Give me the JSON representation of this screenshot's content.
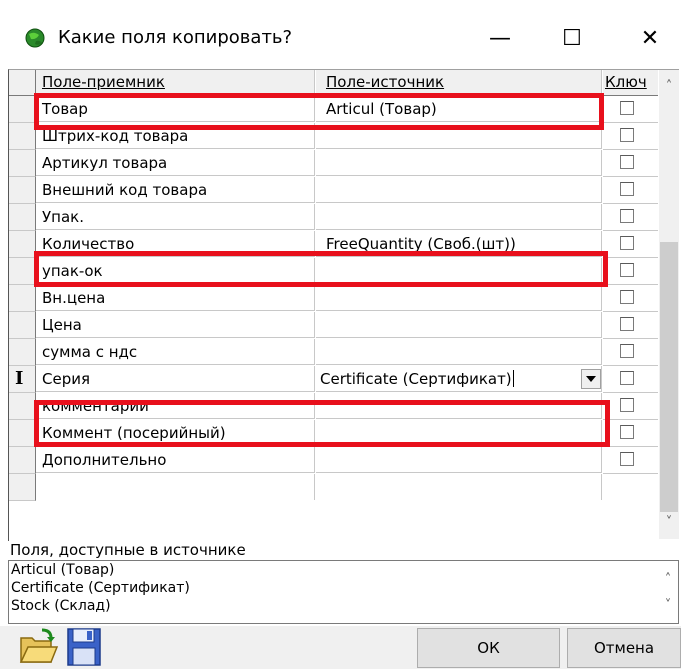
{
  "window": {
    "title": "Какие поля копировать?",
    "controls": {
      "minimize": "—",
      "maximize": "☐",
      "close": "✕"
    }
  },
  "grid": {
    "headers": {
      "target": "Поле-приемник",
      "source": "Поле-источник",
      "key": "Ключ"
    },
    "rows": [
      {
        "target": "Товар",
        "source": "Articul (Товар)"
      },
      {
        "target": "Штрих-код товара",
        "source": ""
      },
      {
        "target": "Артикул товара",
        "source": ""
      },
      {
        "target": "Внешний код товара",
        "source": ""
      },
      {
        "target": "Упак.",
        "source": ""
      },
      {
        "target": "Количество",
        "source": "FreeQuantity (Своб.(шт))"
      },
      {
        "target": "упак-ок",
        "source": ""
      },
      {
        "target": "Вн.цена",
        "source": ""
      },
      {
        "target": "Цена",
        "source": ""
      },
      {
        "target": "сумма с ндс",
        "source": ""
      },
      {
        "target": "Серия",
        "source": "Certificate (Сертификат)"
      },
      {
        "target": "комментарии",
        "source": ""
      },
      {
        "target": "Коммент (посерийный)",
        "source": ""
      },
      {
        "target": "Дополнительно",
        "source": ""
      }
    ],
    "row_cursor": "I"
  },
  "available": {
    "label": "Поля, доступные в источнике",
    "items": [
      "Articul (Товар)",
      "Certificate (Сертификат)",
      "Stock (Склад)"
    ]
  },
  "footer": {
    "ok_label": "ОК",
    "cancel_label": "Отмена"
  },
  "colors": {
    "highlight": "#e8101c"
  }
}
